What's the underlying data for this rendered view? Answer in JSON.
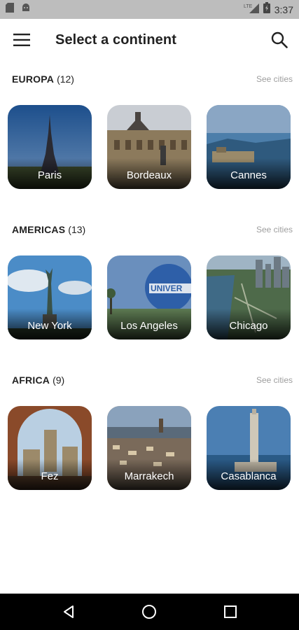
{
  "status_bar": {
    "time": "3:37",
    "network": "LTE",
    "icons": [
      "sd-card-icon",
      "android-debug-icon",
      "signal-icon",
      "battery-charging-icon"
    ]
  },
  "app_bar": {
    "title": "Select a continent",
    "menu_icon": "hamburger-menu-icon",
    "search_icon": "search-icon"
  },
  "sections": [
    {
      "name": "EUROPA",
      "count": "(12)",
      "see_all": "See cities",
      "cities": [
        {
          "label": "Paris",
          "image": "eiffel-tower"
        },
        {
          "label": "Bordeaux",
          "image": "bordeaux-palace"
        },
        {
          "label": "Cannes",
          "image": "cannes-coast"
        }
      ]
    },
    {
      "name": "AMERICAS",
      "count": "(13)",
      "see_all": "See cities",
      "cities": [
        {
          "label": "New York",
          "image": "statue-of-liberty"
        },
        {
          "label": "Los Angeles",
          "image": "universal-globe"
        },
        {
          "label": "Chicago",
          "image": "chicago-skyline"
        }
      ]
    },
    {
      "name": "AFRICA",
      "count": "(9)",
      "see_all": "See cities",
      "cities": [
        {
          "label": "Fez",
          "image": "fez-gate"
        },
        {
          "label": "Marrakech",
          "image": "marrakech-square"
        },
        {
          "label": "Casablanca",
          "image": "hassan-mosque"
        }
      ]
    }
  ],
  "nav_bar": {
    "back_icon": "back-triangle-icon",
    "home_icon": "home-circle-icon",
    "recents_icon": "recents-square-icon"
  }
}
